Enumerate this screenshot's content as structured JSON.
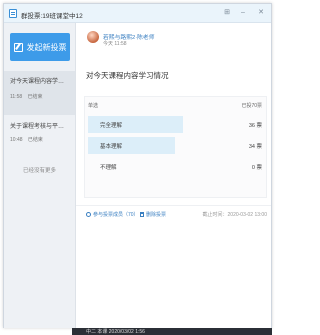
{
  "window": {
    "title": "群投票:19班课堂中12",
    "controls": [
      "pin-icon",
      "minimize-icon",
      "close-icon"
    ]
  },
  "sidebar": {
    "new_vote_label": "发起新投票",
    "items": [
      {
        "title": "对今天课程内容学习情况",
        "time": "11:58",
        "status": "已结束"
      },
      {
        "title": "关于课程考核与平时作业...",
        "time": "10:48",
        "status": "已结束"
      }
    ],
    "no_more": "已经没有更多"
  },
  "main": {
    "author": "若熙与路熙2·陈老师",
    "post_time": "今天 11:58",
    "vote_title": "对今天课程内容学习情况",
    "single_choice": "单选",
    "total_votes": "已投70票",
    "options": [
      {
        "label": "完全理解",
        "count": "36 票",
        "fraction": 0.514
      },
      {
        "label": "基本理解",
        "count": "34 票",
        "fraction": 0.486
      },
      {
        "label": "不理解",
        "count": "0 票",
        "fraction": 0
      }
    ],
    "participants_link": "参与投票成员（70）",
    "delete_link": "删除投票",
    "deadline": "截止时间：2020-03-02 13:00"
  },
  "taskbar": {
    "text": "中二 本课 2020/03/02 1:56"
  },
  "colors": {
    "accent": "#3d9be9",
    "bar_fill": "#dceef9",
    "link": "#3a7fc1"
  }
}
